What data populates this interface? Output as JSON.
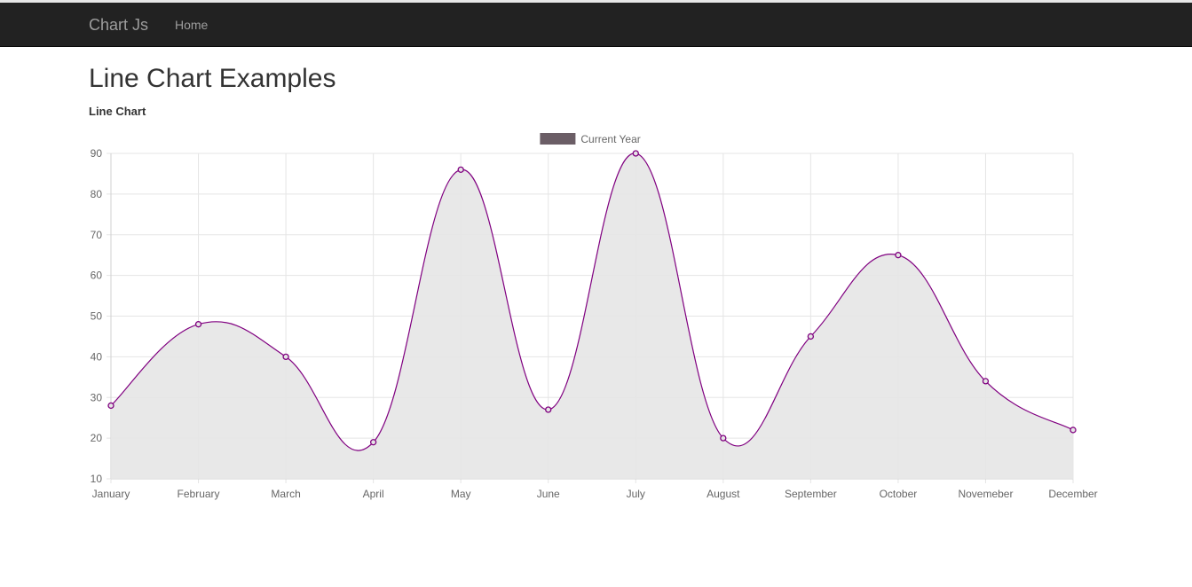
{
  "navbar": {
    "brand": "Chart Js",
    "links": [
      "Home"
    ]
  },
  "page": {
    "title": "Line Chart Examples",
    "subtitle": "Line Chart"
  },
  "colors": {
    "navbar_bg": "#222222",
    "line": "#800080",
    "fill": "#e5e5e5",
    "legend_box": "#6b5e66",
    "grid": "#e5e5e5"
  },
  "chart_data": {
    "type": "line",
    "categories": [
      "January",
      "February",
      "March",
      "April",
      "May",
      "June",
      "July",
      "August",
      "September",
      "October",
      "Novemeber",
      "December"
    ],
    "series": [
      {
        "name": "Current Year",
        "values": [
          28,
          48,
          40,
          19,
          86,
          27,
          90,
          20,
          45,
          65,
          34,
          22
        ]
      }
    ],
    "ylim": [
      10,
      90
    ],
    "yticks": [
      10,
      20,
      30,
      40,
      50,
      60,
      70,
      80,
      90
    ],
    "grid": true,
    "filled": true,
    "smooth": true,
    "legend_position": "top"
  }
}
